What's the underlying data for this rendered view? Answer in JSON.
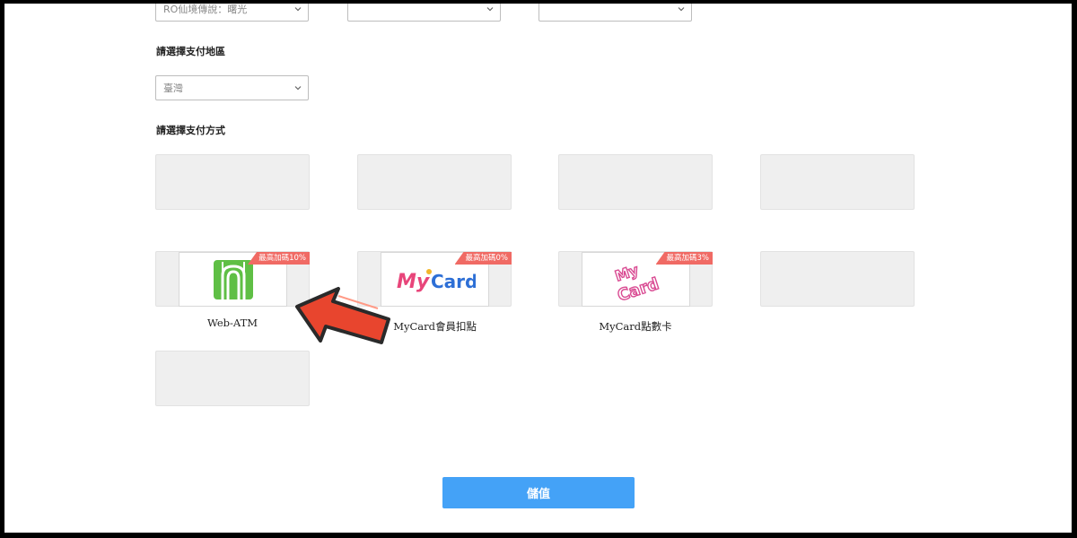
{
  "top_selects": [
    {
      "value": "RO仙境傳說：曙光"
    },
    {
      "value": ""
    },
    {
      "value": ""
    }
  ],
  "region": {
    "label": "請選擇支付地區",
    "selected": "臺灣"
  },
  "payment": {
    "label": "請選擇支付方式",
    "methods": [
      {
        "name": "Web-ATM",
        "badge": "最高加碼10%"
      },
      {
        "name": "MyCard會員扣點",
        "badge": "最高加碼0%",
        "logo_text": "MyCard"
      },
      {
        "name": "MyCard點數卡",
        "badge": "最高加碼3%",
        "logo_line1": "My",
        "logo_line2": "Card"
      }
    ]
  },
  "submit_label": "儲值",
  "colors": {
    "accent": "#44a2f7",
    "badge": "#f06a64",
    "arrow": "#e8452e",
    "webatm_green": "#5fbf45"
  },
  "icons": [
    "chevron-down-icon",
    "web-atm-logo-icon",
    "mycard-logo-icon",
    "mycard-point-card-logo-icon",
    "red-arrow-annotation-icon"
  ]
}
